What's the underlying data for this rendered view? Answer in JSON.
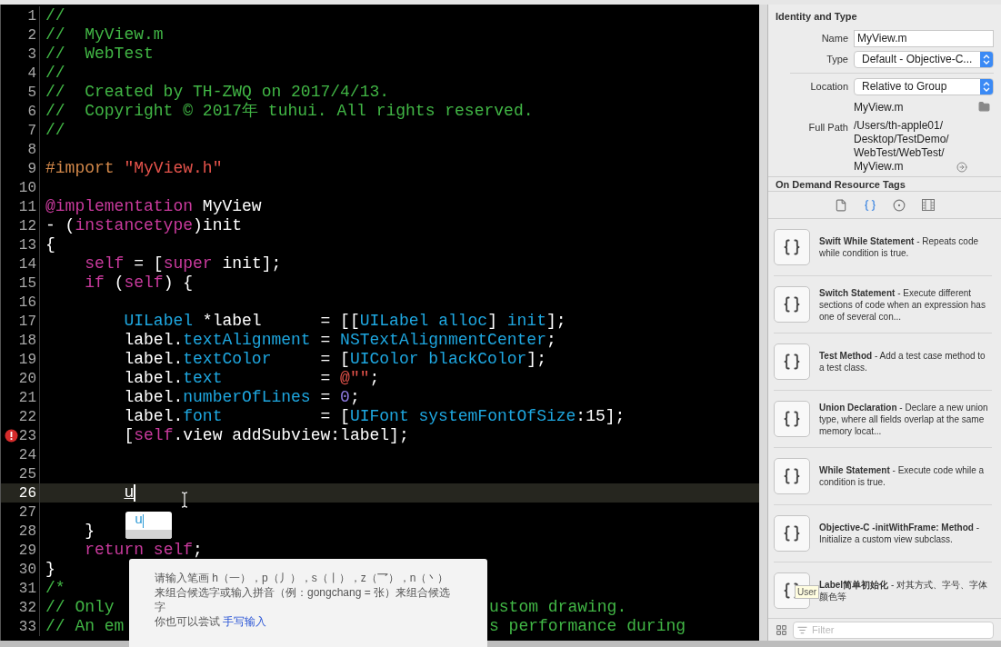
{
  "editor": {
    "lines": [
      {
        "num": "1",
        "parts": [
          [
            {
              "kind": "comment",
              "text": "//"
            }
          ]
        ]
      },
      {
        "num": "2",
        "parts": [
          [
            {
              "kind": "comment",
              "text": "//  MyView.m"
            }
          ]
        ]
      },
      {
        "num": "3",
        "parts": [
          [
            {
              "kind": "comment",
              "text": "//  WebTest"
            }
          ]
        ]
      },
      {
        "num": "4",
        "parts": [
          [
            {
              "kind": "comment",
              "text": "//"
            }
          ]
        ]
      },
      {
        "num": "5",
        "parts": [
          [
            {
              "kind": "comment",
              "text": "//  Created by TH-ZWQ on 2017/4/13."
            }
          ]
        ]
      },
      {
        "num": "6",
        "parts": [
          [
            {
              "kind": "comment",
              "text": "//  Copyright © 2017年 tuhui. All rights reserved."
            }
          ]
        ]
      },
      {
        "num": "7",
        "parts": [
          [
            {
              "kind": "comment",
              "text": "//"
            }
          ]
        ]
      },
      {
        "num": "8"
      },
      {
        "num": "9",
        "parts": [
          [
            {
              "kind": "preprocessor",
              "text": "#import "
            },
            {
              "kind": "string",
              "text": "\"MyView.h\""
            }
          ]
        ]
      },
      {
        "num": "10"
      },
      {
        "num": "11",
        "parts": [
          [
            {
              "kind": "keyword",
              "text": "@implementation"
            },
            {
              "kind": "plain",
              "text": " MyView"
            }
          ]
        ]
      },
      {
        "num": "12",
        "parts": [
          [
            {
              "kind": "plain",
              "text": "- ("
            },
            {
              "kind": "keyword",
              "text": "instancetype"
            },
            {
              "kind": "plain",
              "text": ")init"
            }
          ]
        ]
      },
      {
        "num": "13",
        "parts": [
          [
            {
              "kind": "plain",
              "text": "{"
            }
          ]
        ]
      },
      {
        "num": "14",
        "parts": [
          [
            {
              "kind": "keyword",
              "text": "    self"
            },
            {
              "kind": "plain",
              "text": " = ["
            },
            {
              "kind": "keyword",
              "text": "super"
            },
            {
              "kind": "plain",
              "text": " init];"
            }
          ]
        ]
      },
      {
        "num": "15",
        "parts": [
          [
            {
              "kind": "keyword",
              "text": "    if"
            },
            {
              "kind": "plain",
              "text": " ("
            },
            {
              "kind": "keyword",
              "text": "self"
            },
            {
              "kind": "plain",
              "text": ") {"
            }
          ]
        ]
      },
      {
        "num": "16"
      },
      {
        "num": "17",
        "parts": [
          [
            {
              "kind": "type",
              "text": "        UILabel"
            },
            {
              "kind": "plain",
              "text": " *label      = [["
            },
            {
              "kind": "type",
              "text": "UILabel"
            },
            {
              "kind": "type",
              "text": " alloc"
            },
            {
              "kind": "plain",
              "text": "] "
            },
            {
              "kind": "type",
              "text": "init"
            },
            {
              "kind": "plain",
              "text": "];"
            }
          ]
        ]
      },
      {
        "num": "18",
        "parts": [
          [
            {
              "kind": "plain",
              "text": "        label."
            },
            {
              "kind": "type",
              "text": "textAlignment"
            },
            {
              "kind": "plain",
              "text": " = "
            },
            {
              "kind": "type",
              "text": "NSTextAlignmentCenter"
            },
            {
              "kind": "plain",
              "text": ";"
            }
          ]
        ]
      },
      {
        "num": "19",
        "parts": [
          [
            {
              "kind": "plain",
              "text": "        label."
            },
            {
              "kind": "type",
              "text": "textColor"
            },
            {
              "kind": "plain",
              "text": "     = ["
            },
            {
              "kind": "type",
              "text": "UIColor"
            },
            {
              "kind": "type",
              "text": " blackColor"
            },
            {
              "kind": "plain",
              "text": "];"
            }
          ]
        ]
      },
      {
        "num": "20",
        "parts": [
          [
            {
              "kind": "plain",
              "text": "        label."
            },
            {
              "kind": "type",
              "text": "text"
            },
            {
              "kind": "plain",
              "text": "          = "
            },
            {
              "kind": "string",
              "text": "@\"\""
            },
            {
              "kind": "plain",
              "text": ";"
            }
          ]
        ]
      },
      {
        "num": "21",
        "parts": [
          [
            {
              "kind": "plain",
              "text": "        label."
            },
            {
              "kind": "type",
              "text": "numberOfLines"
            },
            {
              "kind": "plain",
              "text": " = "
            },
            {
              "kind": "number",
              "text": "0"
            },
            {
              "kind": "plain",
              "text": ";"
            }
          ]
        ]
      },
      {
        "num": "22",
        "parts": [
          [
            {
              "kind": "plain",
              "text": "        label."
            },
            {
              "kind": "type",
              "text": "font"
            },
            {
              "kind": "plain",
              "text": "          = ["
            },
            {
              "kind": "type",
              "text": "UIFont"
            },
            {
              "kind": "type",
              "text": " systemFontOfSize"
            },
            {
              "kind": "plain",
              "text": ":15];"
            }
          ]
        ]
      },
      {
        "num": "23",
        "error": true,
        "parts": [
          [
            {
              "kind": "plain",
              "text": "        ["
            },
            {
              "kind": "keyword",
              "text": "self"
            },
            {
              "kind": "plain",
              "text": ".view addSubview:label];"
            }
          ]
        ]
      },
      {
        "num": "24"
      },
      {
        "num": "25"
      },
      {
        "num": "26",
        "current": true,
        "parts": [
          [
            {
              "kind": "marked",
              "text": "        u"
            }
          ]
        ]
      },
      {
        "num": "27"
      },
      {
        "num": "28",
        "parts": [
          [
            {
              "kind": "plain",
              "text": "    }"
            }
          ]
        ]
      },
      {
        "num": "29",
        "parts": [
          [
            {
              "kind": "keyword",
              "text": "    return"
            },
            {
              "kind": "keyword",
              "text": " self"
            },
            {
              "kind": "plain",
              "text": ";"
            }
          ]
        ]
      },
      {
        "num": "30",
        "parts": [
          [
            {
              "kind": "plain",
              "text": "}"
            }
          ]
        ]
      },
      {
        "num": "31",
        "parts": [
          [
            {
              "kind": "comment",
              "text": "/*"
            }
          ]
        ]
      },
      {
        "num": "32",
        "parts": [
          [
            {
              "kind": "comment",
              "text": "// Only"
            }
          ],
          [
            {
              "kind": "comment",
              "text": "ustom drawing."
            }
          ]
        ]
      },
      {
        "num": "33",
        "parts": [
          [
            {
              "kind": "comment",
              "text": "// An em"
            }
          ],
          [
            {
              "kind": "comment",
              "text": "s performance during"
            }
          ]
        ]
      }
    ],
    "completion": {
      "text": "u"
    },
    "ime_hint": {
      "text": "请输入笔画 h（一），p（丿），s（丨），z（乛），n（丶）来组合候选字或输入拼音（例：gongchang = 张）来组合候选字",
      "prefix": "你也可以尝试 ",
      "link": "手写输入"
    }
  },
  "inspector": {
    "section_title": "Identity and Type",
    "name": {
      "label": "Name",
      "value": "MyView.m"
    },
    "type": {
      "label": "Type",
      "value": "Default - Objective-C..."
    },
    "location": {
      "label": "Location",
      "value": "Relative to Group",
      "file": "MyView.m"
    },
    "full_path": {
      "label": "Full Path",
      "lines": [
        "/Users/th-apple01/",
        "Desktop/TestDemo/",
        "WebTest/WebTest/",
        "MyView.m"
      ]
    },
    "next_section_title": "On Demand Resource Tags",
    "library_tabs": [
      {
        "kind": "file",
        "selected": false
      },
      {
        "kind": "braces",
        "selected": true
      },
      {
        "kind": "target",
        "selected": false
      },
      {
        "kind": "media",
        "selected": false
      }
    ],
    "snippets": [
      {
        "text": "**Swift While Statement** - Repeats code while condition is true."
      },
      {
        "text": "**Switch Statement** - Execute different sections of code when an expression has one of several con..."
      },
      {
        "text": "**Test Method** - Add a test case method to a test class."
      },
      {
        "text": "**Union Declaration** - Declare a new union type, where all fields overlap at the same memory locat..."
      },
      {
        "text": "**While Statement** - Execute code while a condition is true."
      },
      {
        "text": "**Objective-C -initWithFrame: Method** - Initialize a custom view subclass."
      },
      {
        "text": "**Label简单初始化** - 对其方式、字号、字体颜色等"
      }
    ],
    "tooltip": "User",
    "filter": {
      "placeholder": "Filter"
    }
  }
}
